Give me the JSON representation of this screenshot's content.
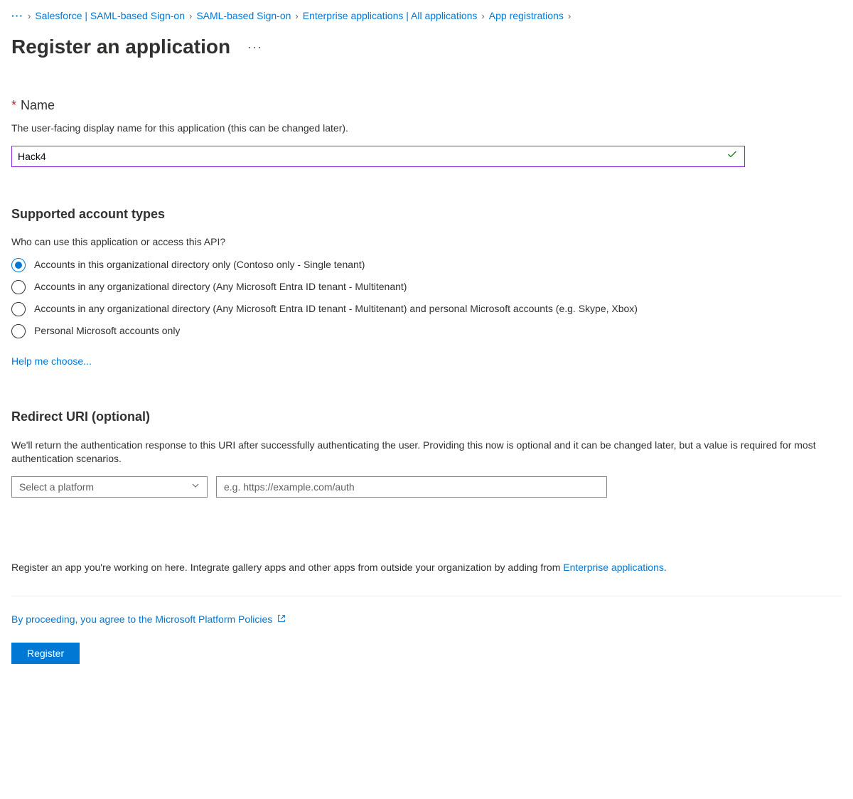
{
  "breadcrumb": {
    "items": [
      "Salesforce | SAML-based Sign-on",
      "SAML-based Sign-on",
      "Enterprise applications | All applications",
      "App registrations"
    ]
  },
  "page": {
    "title": "Register an application"
  },
  "nameSection": {
    "label": "Name",
    "helpText": "The user-facing display name for this application (this can be changed later).",
    "value": "Hack4"
  },
  "accountTypes": {
    "heading": "Supported account types",
    "question": "Who can use this application or access this API?",
    "options": [
      "Accounts in this organizational directory only (Contoso only - Single tenant)",
      "Accounts in any organizational directory (Any Microsoft Entra ID tenant - Multitenant)",
      "Accounts in any organizational directory (Any Microsoft Entra ID tenant - Multitenant) and personal Microsoft accounts (e.g. Skype, Xbox)",
      "Personal Microsoft accounts only"
    ],
    "helpLink": "Help me choose..."
  },
  "redirectUri": {
    "heading": "Redirect URI (optional)",
    "helpText": "We'll return the authentication response to this URI after successfully authenticating the user. Providing this now is optional and it can be changed later, but a value is required for most authentication scenarios.",
    "platformPlaceholder": "Select a platform",
    "uriPlaceholder": "e.g. https://example.com/auth"
  },
  "bottomNote": {
    "textPrefix": "Register an app you're working on here. Integrate gallery apps and other apps from outside your organization by adding from ",
    "linkText": "Enterprise applications",
    "textSuffix": "."
  },
  "policies": {
    "text": "By proceeding, you agree to the Microsoft Platform Policies"
  },
  "actions": {
    "registerLabel": "Register"
  }
}
